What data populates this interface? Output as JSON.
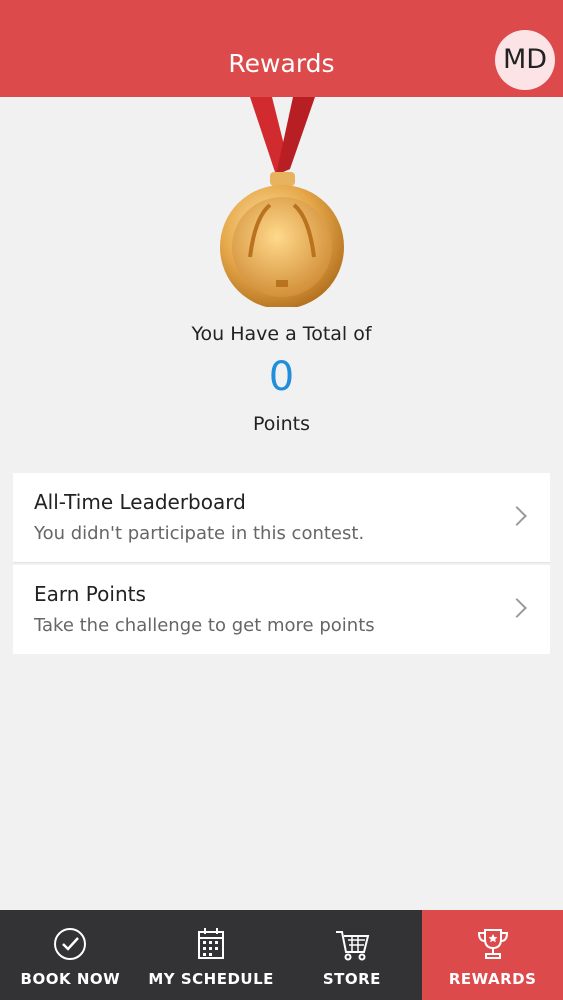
{
  "header": {
    "title": "Rewards",
    "avatar_initials": "MD",
    "color": "#dc4a4c"
  },
  "summary": {
    "total_label": "You Have a Total of",
    "points_value": "0",
    "points_label": "Points",
    "points_color": "#1f8edb",
    "medal_icon": "gold-medal-icon"
  },
  "cards": [
    {
      "title": "All-Time Leaderboard",
      "subtitle": "You didn't participate in this contest.",
      "icon": "chevron-right-icon"
    },
    {
      "title": "Earn Points",
      "subtitle": "Take the challenge to get more points",
      "icon": "chevron-right-icon"
    }
  ],
  "tabbar": {
    "background": "#333335",
    "active_color": "#dc4a4c",
    "active_tab": "REWARDS",
    "tabs": [
      {
        "label": "BOOK NOW",
        "icon": "check-circle-icon"
      },
      {
        "label": "MY SCHEDULE",
        "icon": "calendar-icon"
      },
      {
        "label": "STORE",
        "icon": "cart-icon"
      },
      {
        "label": "REWARDS",
        "icon": "trophy-icon"
      }
    ]
  }
}
